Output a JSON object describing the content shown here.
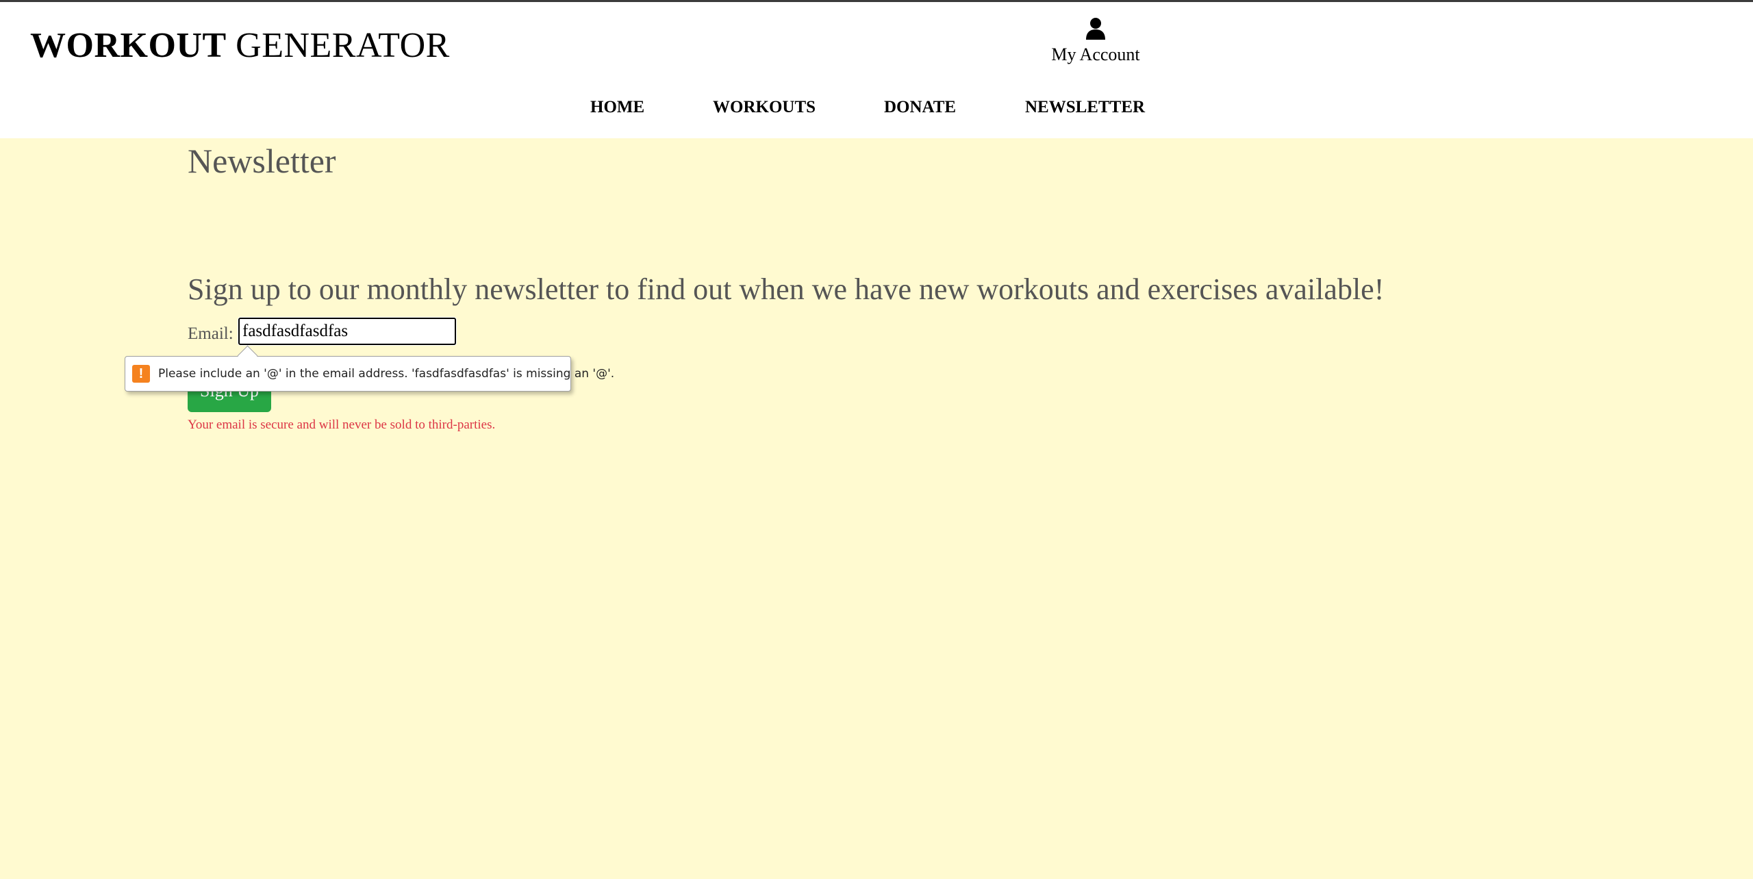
{
  "header": {
    "brand_bold": "WORKOUT",
    "brand_regular": "GENERATOR",
    "account_label": "My Account",
    "account_icon": "user-icon"
  },
  "nav": {
    "items": [
      {
        "label": "HOME"
      },
      {
        "label": "WORKOUTS"
      },
      {
        "label": "DONATE"
      },
      {
        "label": "NEWSLETTER"
      }
    ]
  },
  "main": {
    "title": "Newsletter",
    "lead": "Sign up to our monthly newsletter to find out when we have new workouts and exercises available!",
    "email_label": "Email:",
    "email_value": "fasdfasdfasdfas",
    "signup_label": "Sign Up",
    "secure_note": "Your email is secure and will never be sold to third-parties."
  },
  "validation": {
    "icon": "warning-icon",
    "icon_glyph": "!",
    "message": "Please include an '@' in the email address. 'fasdfasdfasdfas' is missing an '@'."
  },
  "colors": {
    "background": "#fffad0",
    "button": "#28a745",
    "note": "#dc3545",
    "warning": "#f5821f"
  }
}
